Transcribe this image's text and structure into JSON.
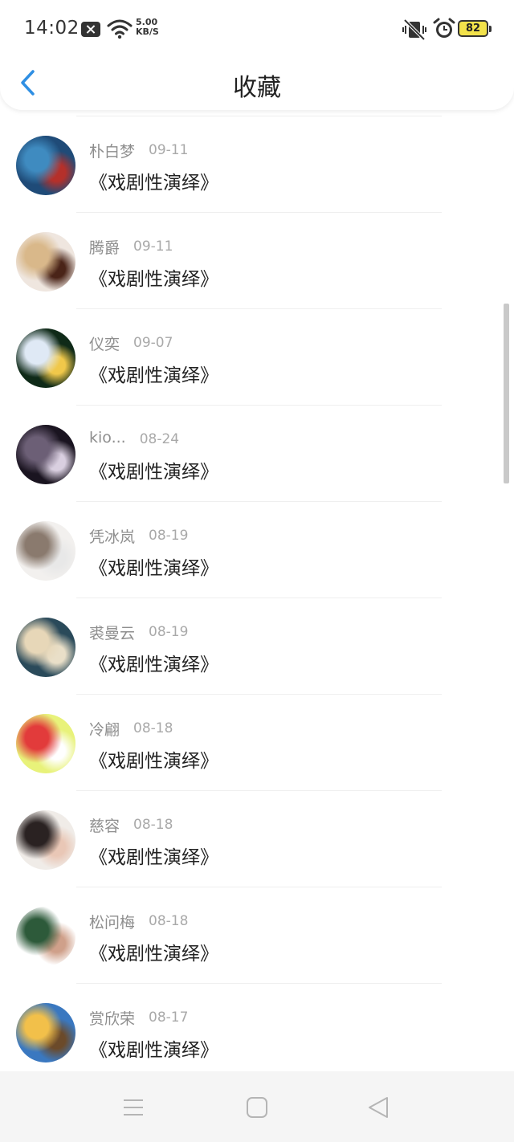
{
  "status": {
    "time": "14:02",
    "net_speed_value": "5.00",
    "net_speed_unit": "KB/S",
    "battery": "82"
  },
  "header": {
    "title": "收藏"
  },
  "items": [
    {
      "name": "朴白梦",
      "date": "09-11",
      "work": "《戏剧性演绎》",
      "avatar_colors": [
        "#1f4b78",
        "#3f8bc0",
        "#b5302a"
      ]
    },
    {
      "name": "腾爵",
      "date": "09-11",
      "work": "《戏剧性演绎》",
      "avatar_colors": [
        "#efe6df",
        "#d9b88a",
        "#4a2418"
      ]
    },
    {
      "name": "仪奕",
      "date": "09-07",
      "work": "《戏剧性演绎》",
      "avatar_colors": [
        "#0f2a18",
        "#dfe9f5",
        "#f0c84a"
      ]
    },
    {
      "name": "kio...",
      "date": "08-24",
      "work": "《戏剧性演绎》",
      "avatar_colors": [
        "#1a1420",
        "#6c5f76",
        "#d9cfe0"
      ]
    },
    {
      "name": "凭冰岚",
      "date": "08-19",
      "work": "《戏剧性演绎》",
      "avatar_colors": [
        "#f2f0ee",
        "#8a7a6e",
        "#e8e8e8"
      ]
    },
    {
      "name": "裘曼云",
      "date": "08-19",
      "work": "《戏剧性演绎》",
      "avatar_colors": [
        "#2a4a5a",
        "#e7d7b8",
        "#e9dfc8"
      ]
    },
    {
      "name": "冷翩",
      "date": "08-18",
      "work": "《戏剧性演绎》",
      "avatar_colors": [
        "#e8f27a",
        "#e23b3b",
        "#ffffff"
      ]
    },
    {
      "name": "慈容",
      "date": "08-18",
      "work": "《戏剧性演绎》",
      "avatar_colors": [
        "#f0ece8",
        "#2a2222",
        "#e9c7b6"
      ]
    },
    {
      "name": "松问梅",
      "date": "08-18",
      "work": "《戏剧性演绎》",
      "avatar_colors": [
        "#ffffff",
        "#2d5a3a",
        "#cfa08a"
      ]
    },
    {
      "name": "赏欣荣",
      "date": "08-17",
      "work": "《戏剧性演绎》",
      "avatar_colors": [
        "#3a78c0",
        "#f2c04a",
        "#6b4a2a"
      ]
    }
  ],
  "icons": {
    "back": "chevron-left-icon",
    "nav": [
      "menu-icon",
      "home-square-icon",
      "back-triangle-icon"
    ]
  },
  "colors": {
    "accent": "#2f8fe3",
    "title": "#222222",
    "name": "#8e8e8e",
    "date": "#a9a9a9"
  }
}
